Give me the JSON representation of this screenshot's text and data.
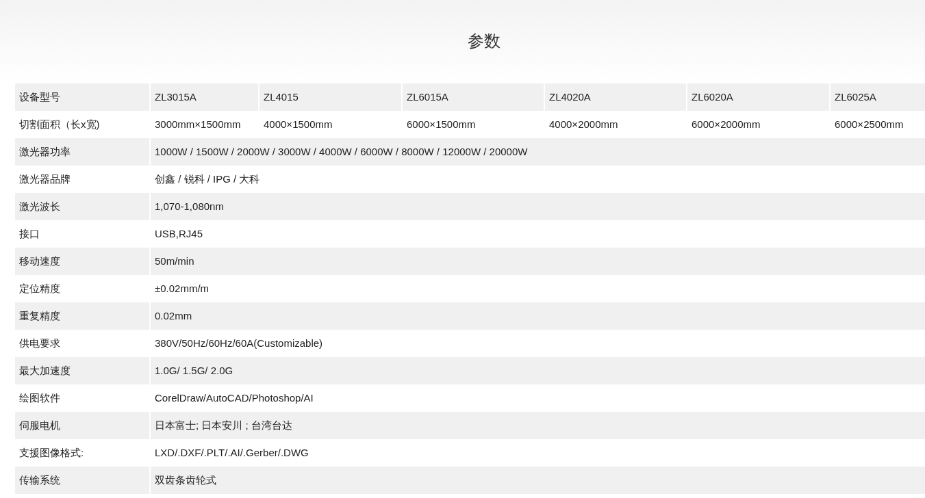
{
  "title": "参数",
  "table": {
    "rows": [
      {
        "label": "设备型号",
        "values": [
          "ZL3015A",
          "ZL4015",
          "ZL6015A",
          "ZL4020A",
          "ZL6020A",
          "ZL6025A"
        ]
      },
      {
        "label": "切割面积（长x宽)",
        "values": [
          "3000mm×1500mm",
          "4000×1500mm",
          "6000×1500mm",
          "4000×2000mm",
          "6000×2000mm",
          "6000×2500mm"
        ]
      },
      {
        "label": "激光器功率",
        "values": [
          "1000W / 1500W / 2000W / 3000W / 4000W / 6000W / 8000W / 12000W / 20000W"
        ]
      },
      {
        "label": "激光器品牌",
        "values": [
          "创鑫 / 锐科 / IPG / 大科"
        ]
      },
      {
        "label": "激光波长",
        "values": [
          "1,070-1,080nm"
        ]
      },
      {
        "label": "接口",
        "values": [
          "USB,RJ45"
        ]
      },
      {
        "label": "移动速度",
        "values": [
          "50m/min"
        ]
      },
      {
        "label": "定位精度",
        "values": [
          "±0.02mm/m"
        ]
      },
      {
        "label": "重复精度",
        "values": [
          "0.02mm"
        ]
      },
      {
        "label": "供电要求",
        "values": [
          "380V/50Hz/60Hz/60A(Customizable)"
        ]
      },
      {
        "label": "最大加速度",
        "values": [
          "1.0G/ 1.5G/ 2.0G"
        ]
      },
      {
        "label": "绘图软件",
        "values": [
          "CorelDraw/AutoCAD/Photoshop/AI"
        ]
      },
      {
        "label": "伺服电机",
        "values": [
          "日本富士; 日本安川 ; 台湾台达"
        ]
      },
      {
        "label": "支援图像格式:",
        "values": [
          "LXD/.DXF/.PLT/.AI/.Gerber/.DWG"
        ]
      },
      {
        "label": "传输系统",
        "values": [
          "双齿条齿轮式"
        ]
      }
    ]
  }
}
